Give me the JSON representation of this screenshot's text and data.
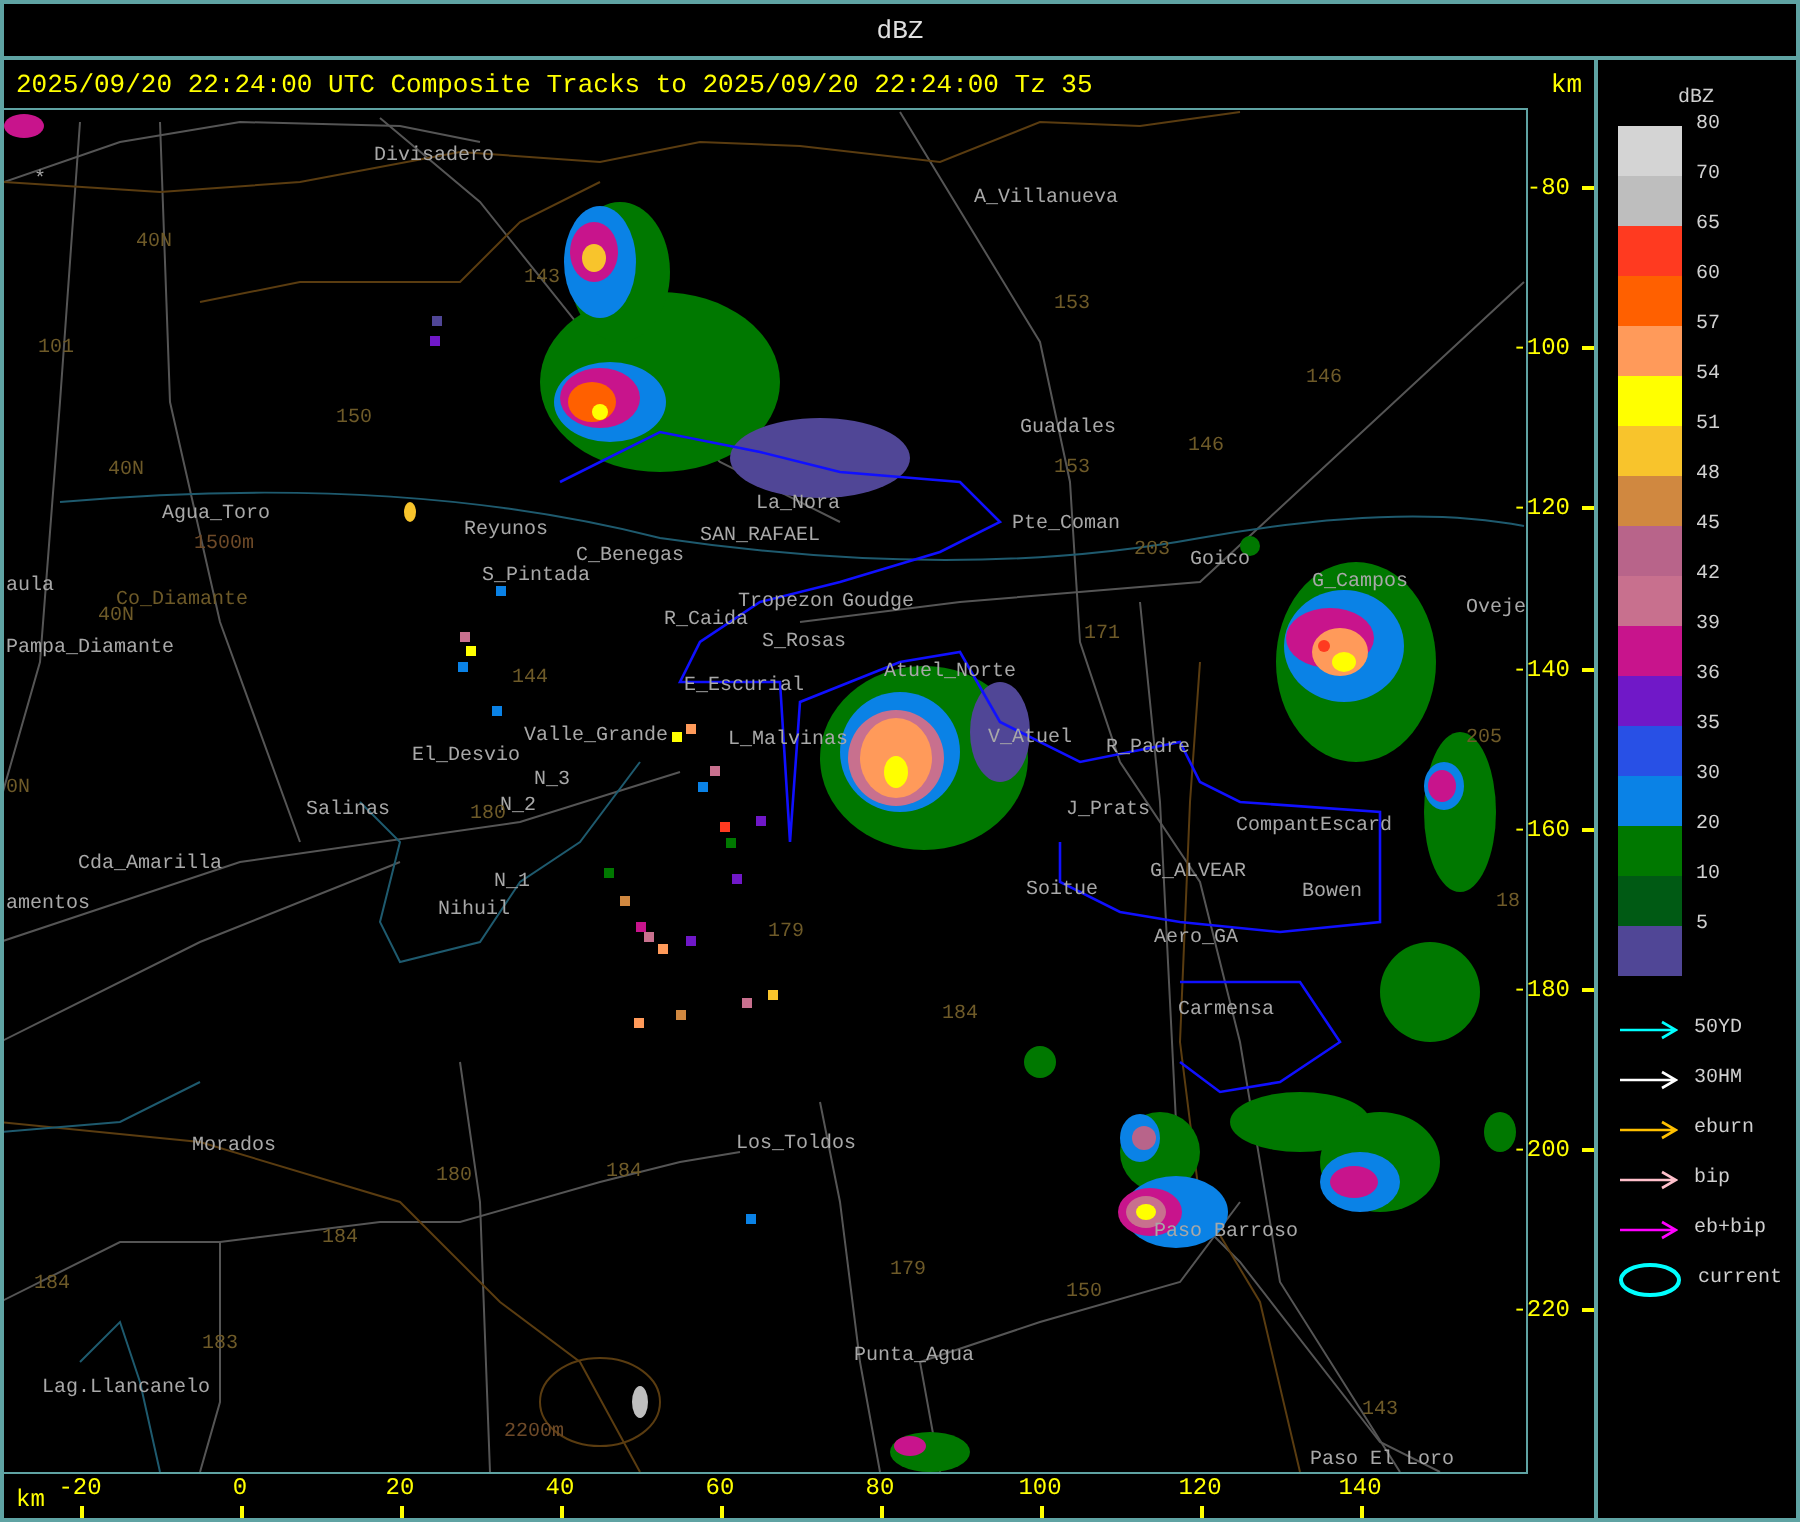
{
  "window": {
    "title": "dBZ"
  },
  "header": {
    "text": "2025/09/20 22:24:00 UTC Composite Tracks to 2025/09/20 22:24:00 Tz 35",
    "unit": "km"
  },
  "map": {
    "labels": [
      {
        "text": "Divisadero",
        "kind": "place"
      },
      {
        "text": "A_Villanueva",
        "kind": "place"
      },
      {
        "text": "Guadales",
        "kind": "place"
      },
      {
        "text": "Agua_Toro",
        "kind": "place"
      },
      {
        "text": "Reyunos",
        "kind": "place"
      },
      {
        "text": "La_Nora",
        "kind": "place"
      },
      {
        "text": "C_Benegas",
        "kind": "place"
      },
      {
        "text": "SAN_RAFAEL",
        "kind": "place"
      },
      {
        "text": "Pte_Coman",
        "kind": "place"
      },
      {
        "text": "S_Pintada",
        "kind": "place"
      },
      {
        "text": "aula",
        "kind": "place"
      },
      {
        "text": "Pampa_Diamante",
        "kind": "place"
      },
      {
        "text": "R_Caida",
        "kind": "place"
      },
      {
        "text": "Tropezon",
        "kind": "place"
      },
      {
        "text": "Goudge",
        "kind": "place"
      },
      {
        "text": "S_Rosas",
        "kind": "place"
      },
      {
        "text": "Goico",
        "kind": "place"
      },
      {
        "text": "G_Campos",
        "kind": "place"
      },
      {
        "text": "Oveje",
        "kind": "place"
      },
      {
        "text": "Atuel_Norte",
        "kind": "place"
      },
      {
        "text": "E_Escurial",
        "kind": "place"
      },
      {
        "text": "Valle_Grande",
        "kind": "place"
      },
      {
        "text": "L_Malvinas",
        "kind": "place"
      },
      {
        "text": "El_Desvio",
        "kind": "place"
      },
      {
        "text": "V_Atuel",
        "kind": "place"
      },
      {
        "text": "R_Padre",
        "kind": "place"
      },
      {
        "text": "N_3",
        "kind": "place"
      },
      {
        "text": "Salinas",
        "kind": "place"
      },
      {
        "text": "N_2",
        "kind": "place"
      },
      {
        "text": "J_Prats",
        "kind": "place"
      },
      {
        "text": "CompantEscard",
        "kind": "place"
      },
      {
        "text": "Cda_Amarilla",
        "kind": "place"
      },
      {
        "text": "G_ALVEAR",
        "kind": "place"
      },
      {
        "text": "N_1",
        "kind": "place"
      },
      {
        "text": "Soitue",
        "kind": "place"
      },
      {
        "text": "Bowen",
        "kind": "place"
      },
      {
        "text": "amentos",
        "kind": "place"
      },
      {
        "text": "Nihuil",
        "kind": "place"
      },
      {
        "text": "Aero_GA",
        "kind": "place"
      },
      {
        "text": "Carmensa",
        "kind": "place"
      },
      {
        "text": "Morados",
        "kind": "place"
      },
      {
        "text": "Los_Toldos",
        "kind": "place"
      },
      {
        "text": "Punta_Agua",
        "kind": "place"
      },
      {
        "text": "Paso Barroso",
        "kind": "place"
      },
      {
        "text": "Lag.Llancanelo",
        "kind": "place"
      },
      {
        "text": "Paso El Loro",
        "kind": "place"
      },
      {
        "text": "*",
        "kind": "marker"
      },
      {
        "text": "40N",
        "kind": "route"
      },
      {
        "text": "143",
        "kind": "route"
      },
      {
        "text": "153",
        "kind": "route"
      },
      {
        "text": "101",
        "kind": "route"
      },
      {
        "text": "146",
        "kind": "route"
      },
      {
        "text": "150",
        "kind": "route"
      },
      {
        "text": "146",
        "kind": "route"
      },
      {
        "text": "153",
        "kind": "route"
      },
      {
        "text": "40N",
        "kind": "route"
      },
      {
        "text": "203",
        "kind": "route"
      },
      {
        "text": "Co_Diamante",
        "kind": "route"
      },
      {
        "text": "40N",
        "kind": "route"
      },
      {
        "text": "171",
        "kind": "route"
      },
      {
        "text": "144",
        "kind": "route"
      },
      {
        "text": "0N",
        "kind": "route"
      },
      {
        "text": "180",
        "kind": "route"
      },
      {
        "text": "179",
        "kind": "route"
      },
      {
        "text": "205",
        "kind": "route"
      },
      {
        "text": "184",
        "kind": "route"
      },
      {
        "text": "18",
        "kind": "route"
      },
      {
        "text": "180",
        "kind": "route"
      },
      {
        "text": "184",
        "kind": "route"
      },
      {
        "text": "184",
        "kind": "route"
      },
      {
        "text": "184",
        "kind": "route"
      },
      {
        "text": "179",
        "kind": "route"
      },
      {
        "text": "150",
        "kind": "route"
      },
      {
        "text": "183",
        "kind": "route"
      },
      {
        "text": "143",
        "kind": "route"
      },
      {
        "text": "1500m",
        "kind": "elevation"
      },
      {
        "text": "2200m",
        "kind": "elevation"
      }
    ]
  },
  "y_axis": {
    "ticks": [
      "-80",
      "-100",
      "-120",
      "-140",
      "-160",
      "-180",
      "-200",
      "-220"
    ]
  },
  "x_axis": {
    "unit": "km",
    "ticks": [
      "-20",
      "0",
      "20",
      "40",
      "60",
      "80",
      "100",
      "120",
      "140"
    ]
  },
  "legend": {
    "title": "dBZ",
    "scale": [
      {
        "label": "80",
        "color": "#d4d4d4"
      },
      {
        "label": "70",
        "color": "#bebebe"
      },
      {
        "label": "65",
        "color": "#ff3a20"
      },
      {
        "label": "60",
        "color": "#ff6000"
      },
      {
        "label": "57",
        "color": "#ff9a5a"
      },
      {
        "label": "54",
        "color": "#ffff00"
      },
      {
        "label": "51",
        "color": "#f8c42c"
      },
      {
        "label": "48",
        "color": "#d08840"
      },
      {
        "label": "45",
        "color": "#b8648a"
      },
      {
        "label": "42",
        "color": "#c8708e"
      },
      {
        "label": "39",
        "color": "#c8148c"
      },
      {
        "label": "36",
        "color": "#7018c8"
      },
      {
        "label": "35",
        "color": "#2850e6"
      },
      {
        "label": "30",
        "color": "#0a82e6"
      },
      {
        "label": "20",
        "color": "#007800"
      },
      {
        "label": "10",
        "color": "#005a14"
      },
      {
        "label": "5",
        "color": "#504696"
      }
    ],
    "tracks": [
      {
        "label": "50YD",
        "kind": "arrow",
        "color": "#00ffff"
      },
      {
        "label": "30HM",
        "kind": "arrow",
        "color": "#ffffff"
      },
      {
        "label": "eburn",
        "kind": "arrow",
        "color": "#ffc000"
      },
      {
        "label": "bip",
        "kind": "arrow",
        "color": "#ffc0cb"
      },
      {
        "label": "eb+bip",
        "kind": "arrow",
        "color": "#ff00ff"
      },
      {
        "label": "current",
        "kind": "ellipse",
        "color": "#00ffff"
      }
    ]
  }
}
